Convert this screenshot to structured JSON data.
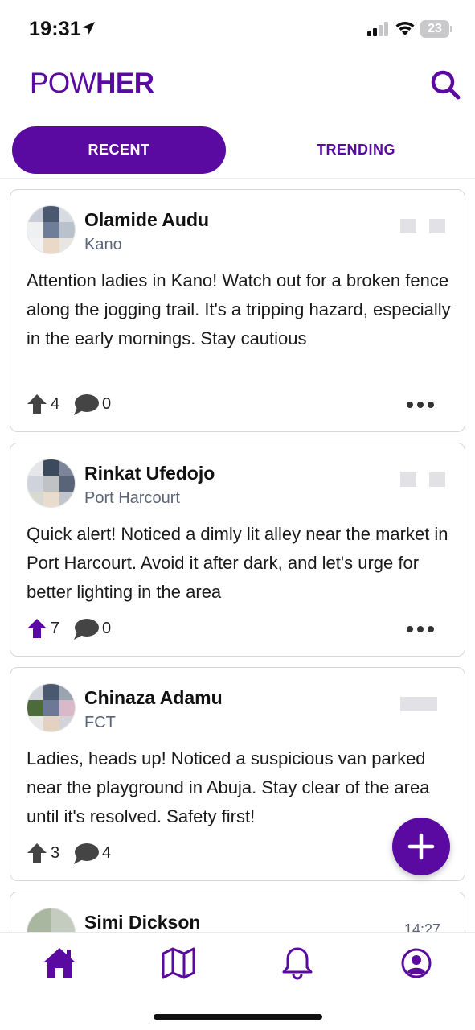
{
  "status_bar": {
    "time": "19:31",
    "battery_level": "23",
    "location_icon": "location-arrow-icon",
    "signal_icon": "cellular-signal-icon",
    "wifi_icon": "wifi-icon"
  },
  "header": {
    "title_light": "POW",
    "title_bold": "HER",
    "search_icon": "search-icon"
  },
  "tabs": [
    {
      "label": "RECENT",
      "active": true
    },
    {
      "label": "TRENDING",
      "active": false
    }
  ],
  "colors": {
    "brand": "#5a0aa0",
    "text_secondary": "#5b6478",
    "card_border": "#d7d7d7"
  },
  "posts": [
    {
      "author": "Olamide Audu",
      "location": "Kano",
      "text": "Attention ladies in Kano! Watch out for a broken fence along the jogging trail. It's a tripping hazard, especially in the early mornings. Stay cautious",
      "upvotes": "4",
      "comments": "0",
      "upvoted": false
    },
    {
      "author": "Rinkat Ufedojo",
      "location": "Port Harcourt",
      "text": "Quick alert! Noticed a dimly lit alley near the market in Port Harcourt. Avoid it after dark, and let's urge for better lighting in the area",
      "upvotes": "7",
      "comments": "0",
      "upvoted": true
    },
    {
      "author": "Chinaza Adamu",
      "location": "FCT",
      "text": "Ladies, heads up! Noticed a suspicious van parked near the playground in Abuja. Stay clear of the area until it's resolved. Safety first!",
      "upvotes": "3",
      "comments": "4",
      "upvoted": false
    },
    {
      "author": "Simi Dickson",
      "time": "14:27"
    }
  ],
  "fab": {
    "icon": "plus-icon"
  },
  "bottom_nav": [
    {
      "name": "home",
      "icon": "home-icon",
      "active": true
    },
    {
      "name": "map",
      "icon": "map-icon",
      "active": false
    },
    {
      "name": "notifications",
      "icon": "bell-icon",
      "active": false
    },
    {
      "name": "profile",
      "icon": "user-circle-icon",
      "active": false
    }
  ]
}
